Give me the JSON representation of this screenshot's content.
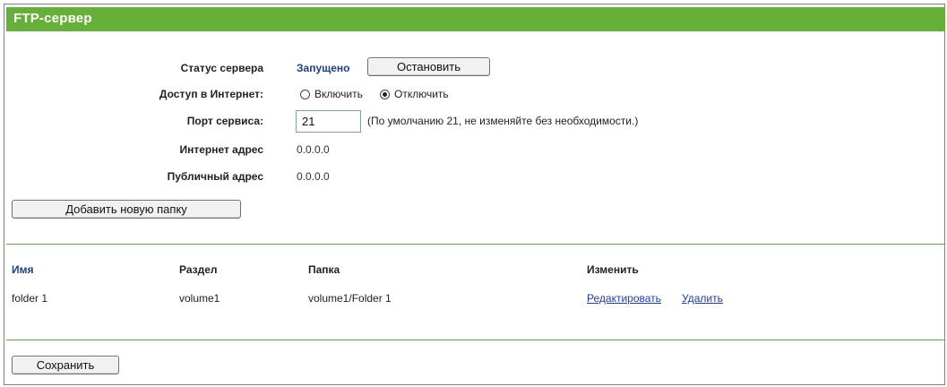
{
  "title": "FTP-сервер",
  "server_status": {
    "label": "Статус сервера",
    "value": "Запущено",
    "stop_button": "Остановить"
  },
  "internet_access": {
    "label": "Доступ в Интернет:",
    "options": [
      "Включить",
      "Отключить"
    ],
    "selected": "Отключить"
  },
  "service_port": {
    "label": "Порт сервиса:",
    "value": "21",
    "hint": "(По умолчанию 21, не изменяйте без необходимости.)"
  },
  "internet_address": {
    "label": "Интернет адрес",
    "value": "0.0.0.0"
  },
  "public_address": {
    "label": "Публичный адрес",
    "value": "0.0.0.0"
  },
  "add_folder_button": "Добавить новую папку",
  "table": {
    "headers": {
      "name": "Имя",
      "partition": "Раздел",
      "folder": "Папка",
      "modify": "Изменить"
    },
    "rows": [
      {
        "name": "folder 1",
        "partition": "volume1",
        "folder": "volume1/Folder 1",
        "edit": "Редактировать",
        "delete": "Удалить"
      }
    ]
  },
  "save_button": "Сохранить",
  "colors": {
    "title_bar": "#66b03a",
    "divider": "#66a34a",
    "link": "#1d3bb2",
    "status_value": "#1e3f8a"
  }
}
